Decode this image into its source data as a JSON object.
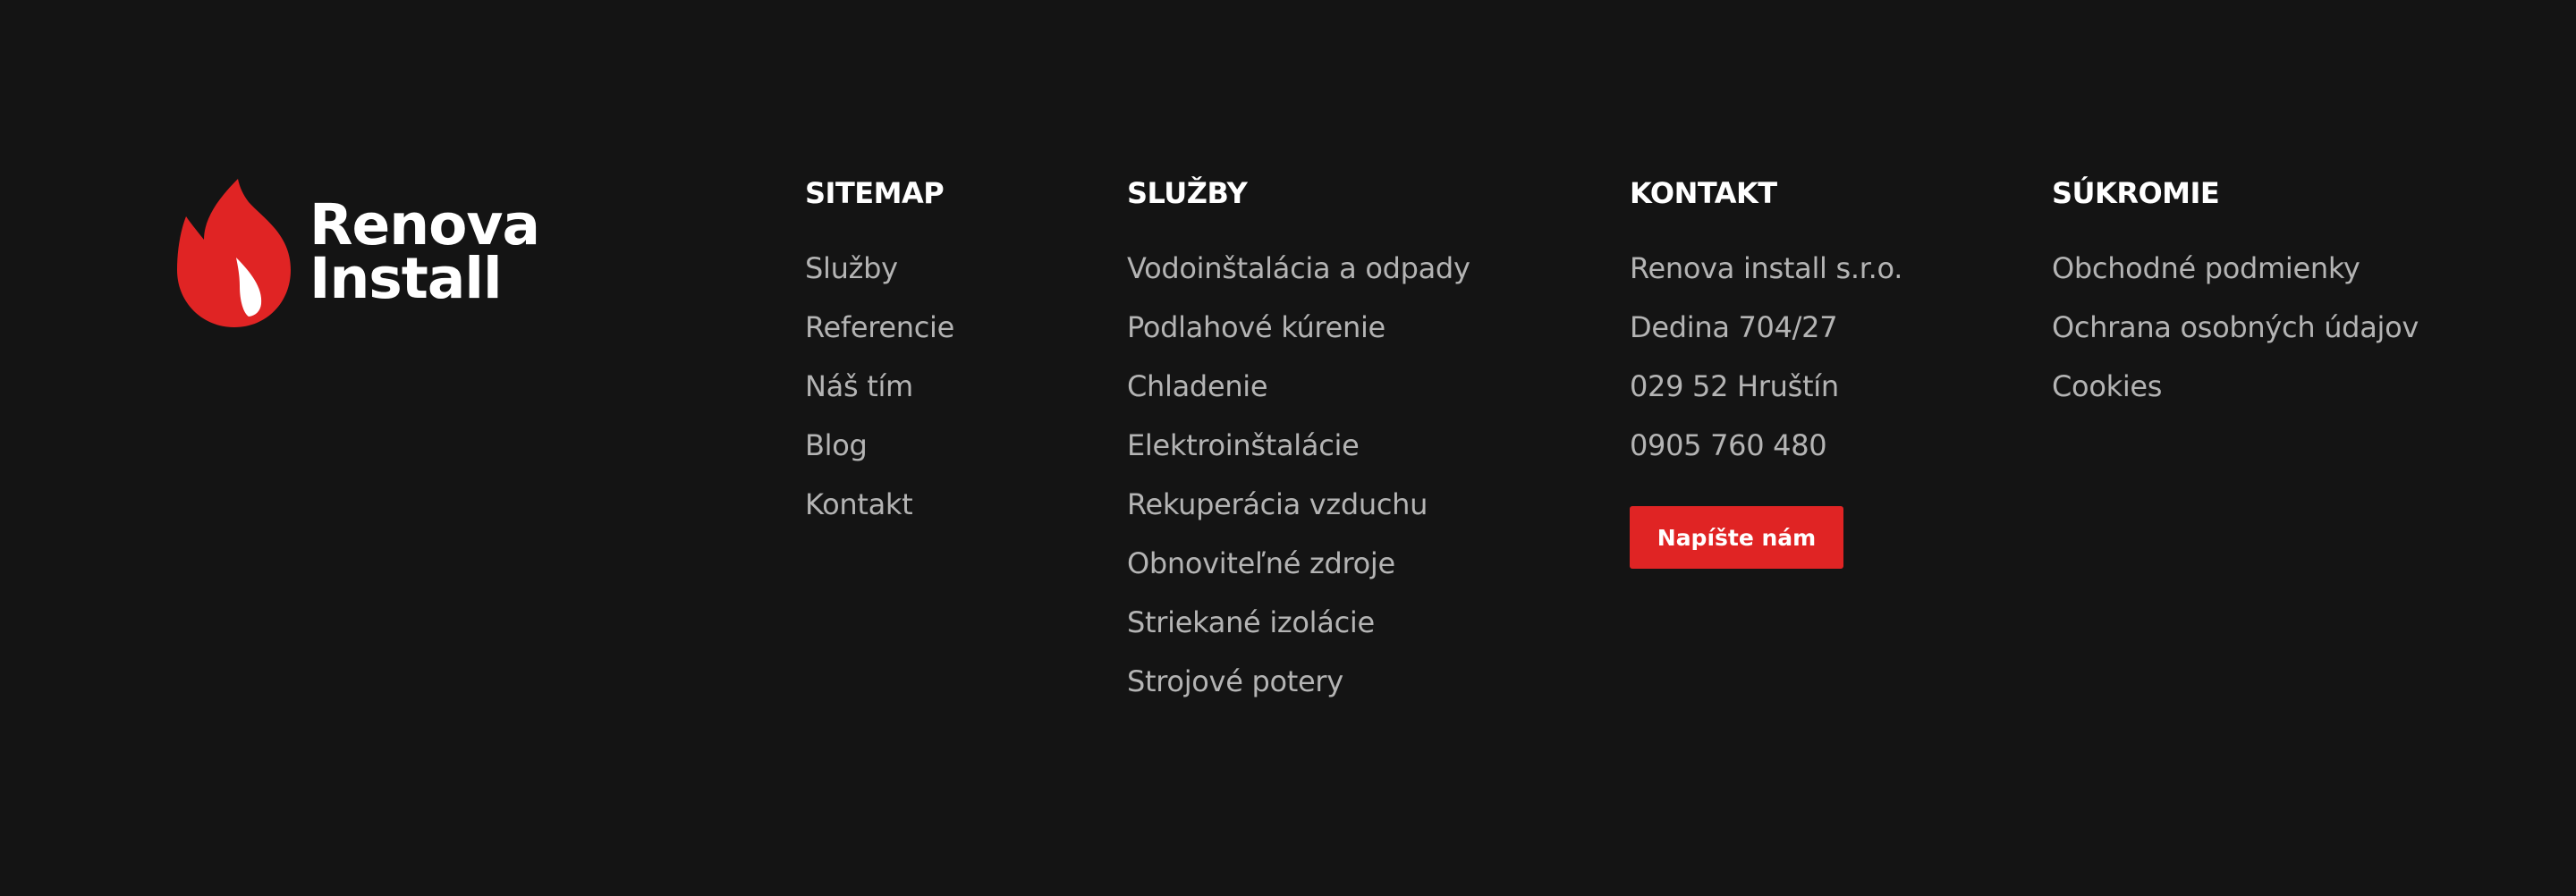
{
  "brand": {
    "line1": "Renova",
    "line2": "Install",
    "icon": "flame-icon",
    "accent_color": "#e02424"
  },
  "sitemap": {
    "heading": "SITEMAP",
    "items": [
      "Služby",
      "Referencie",
      "Náš tím",
      "Blog",
      "Kontakt"
    ]
  },
  "services": {
    "heading": "SLUŽBY",
    "items": [
      "Vodoinštalácia a odpady",
      "Podlahové kúrenie",
      "Chladenie",
      "Elektroinštalácie",
      "Rekuperácia vzduchu",
      "Obnoviteľné zdroje",
      "Striekané izolácie",
      "Strojové potery"
    ]
  },
  "contact": {
    "heading": "KONTAKT",
    "company": "Renova install s.r.o.",
    "street": "Dedina 704/27",
    "city": "029 52 Hruštín",
    "phone": "0905 760 480",
    "button_label": "Napíšte nám"
  },
  "privacy": {
    "heading": "SÚKROMIE",
    "items": [
      "Obchodné podmienky",
      "Ochrana osobných údajov",
      "Cookies"
    ]
  },
  "colors": {
    "background": "#141414",
    "heading": "#ffffff",
    "link": "#b4b4b4",
    "button": "#e02424"
  }
}
